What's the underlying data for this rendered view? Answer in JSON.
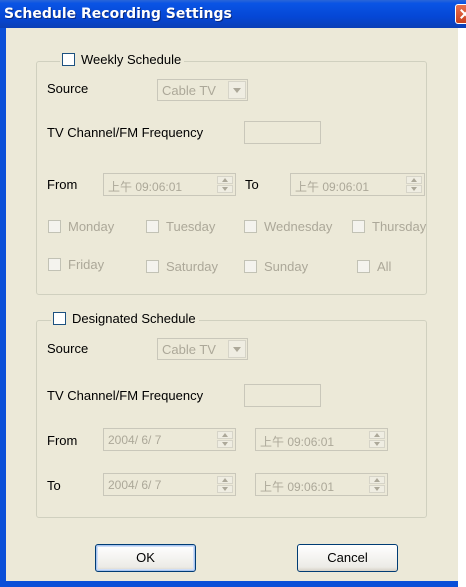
{
  "window": {
    "title": "Schedule Recording Settings"
  },
  "weekly": {
    "title": "Weekly Schedule",
    "source_label": "Source",
    "source_value": "Cable TV",
    "channel_label": "TV Channel/FM Frequency",
    "from_label": "From",
    "from_time": "上午 09:06:01",
    "to_label": "To",
    "to_time": "上午 09:06:01",
    "days": [
      "Monday",
      "Tuesday",
      "Wednesday",
      "Thursday",
      "Friday",
      "Saturday",
      "Sunday",
      "All"
    ]
  },
  "designated": {
    "title": "Designated Schedule",
    "source_label": "Source",
    "source_value": "Cable TV",
    "channel_label": "TV Channel/FM Frequency",
    "from_label": "From",
    "from_date": "2004/ 6/ 7",
    "from_time": "上午 09:06:01",
    "to_label": "To",
    "to_date": "2004/ 6/ 7",
    "to_time": "上午 09:06:01"
  },
  "buttons": {
    "ok": "OK",
    "cancel": "Cancel"
  }
}
